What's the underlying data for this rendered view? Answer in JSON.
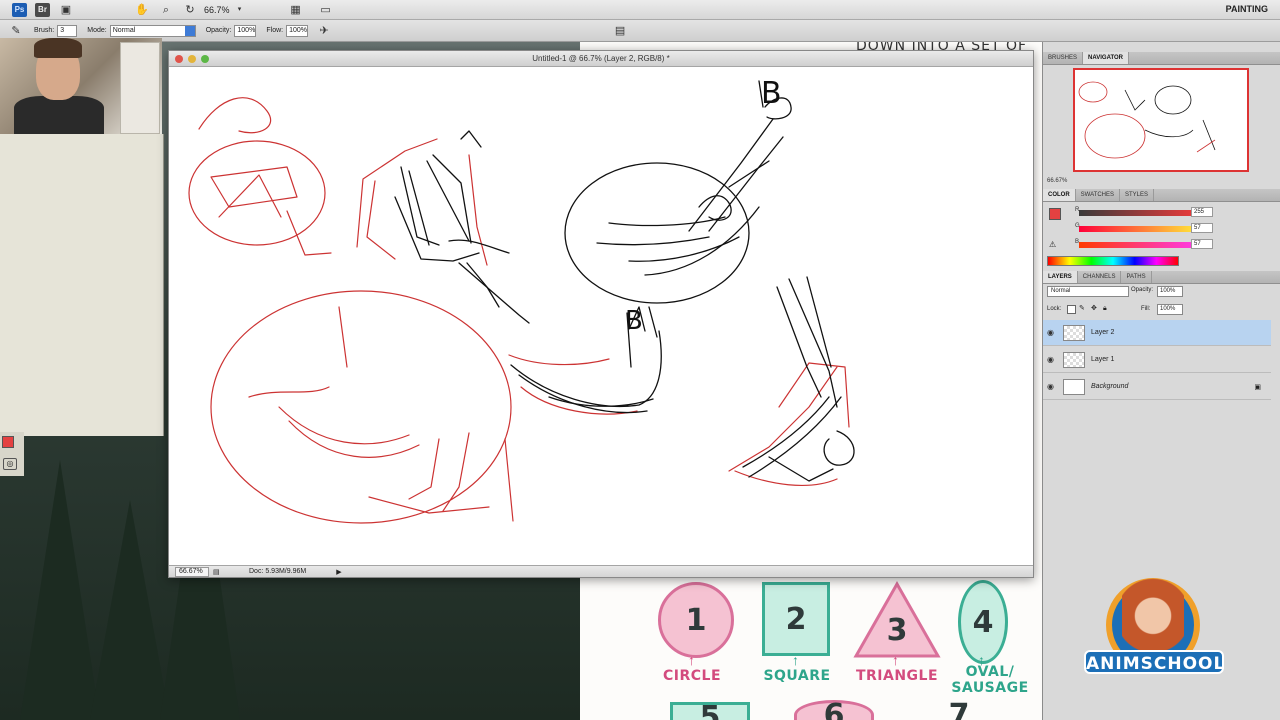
{
  "menubar": {
    "ps_logo": "Ps",
    "br_logo": "Br",
    "zoom_value": "66.7%",
    "workspace": "PAINTING"
  },
  "options_bar": {
    "brush_label": "Brush:",
    "brush_value": "3",
    "mode_label": "Mode:",
    "mode_value": "Normal",
    "opacity_label": "Opacity:",
    "opacity_value": "100%",
    "flow_label": "Flow:",
    "flow_value": "100%"
  },
  "document": {
    "title": "Untitled-1 @ 66.7% (Layer 2, RGB/8) *",
    "status_zoom": "66.67%",
    "doc_size": "Doc: 5.93M/9.96M"
  },
  "navigator_panel": {
    "tabs": [
      "BRUSHES",
      "NAVIGATOR"
    ],
    "active_tab": "NAVIGATOR",
    "zoom": "66.67%"
  },
  "color_panel": {
    "tabs": [
      "COLOR",
      "SWATCHES",
      "STYLES"
    ],
    "active_tab": "COLOR",
    "foreground_color": "#e44141",
    "channels": [
      {
        "label": "R",
        "value": "255"
      },
      {
        "label": "G",
        "value": "57"
      },
      {
        "label": "B",
        "value": "57"
      }
    ]
  },
  "layers_panel": {
    "tabs": [
      "LAYERS",
      "CHANNELS",
      "PATHS"
    ],
    "active_tab": "LAYERS",
    "blend_mode": "Normal",
    "opacity_label": "Opacity:",
    "opacity_value": "100%",
    "lock_label": "Lock:",
    "fill_label": "Fill:",
    "fill_value": "100%",
    "layers": [
      {
        "name": "Layer 2",
        "selected": true
      },
      {
        "name": "Layer 1",
        "selected": false
      },
      {
        "name": "Background",
        "selected": false,
        "locked": true
      }
    ]
  },
  "reference_sheet": {
    "top_text": "DOWN INTO A SET OF",
    "shapes": [
      {
        "number": "1",
        "label": "CIRCLE"
      },
      {
        "number": "2",
        "label": "SQUARE"
      },
      {
        "number": "3",
        "label": "TRIANGLE"
      },
      {
        "number": "4",
        "label": "OVAL/ SAUSAGE"
      }
    ],
    "bottom_numbers": [
      "5",
      "6",
      "7"
    ]
  },
  "canvas_annotations": {
    "mark_a": "B",
    "mark_b": "B"
  },
  "logo": {
    "text": "ANIMSCHOOL"
  }
}
